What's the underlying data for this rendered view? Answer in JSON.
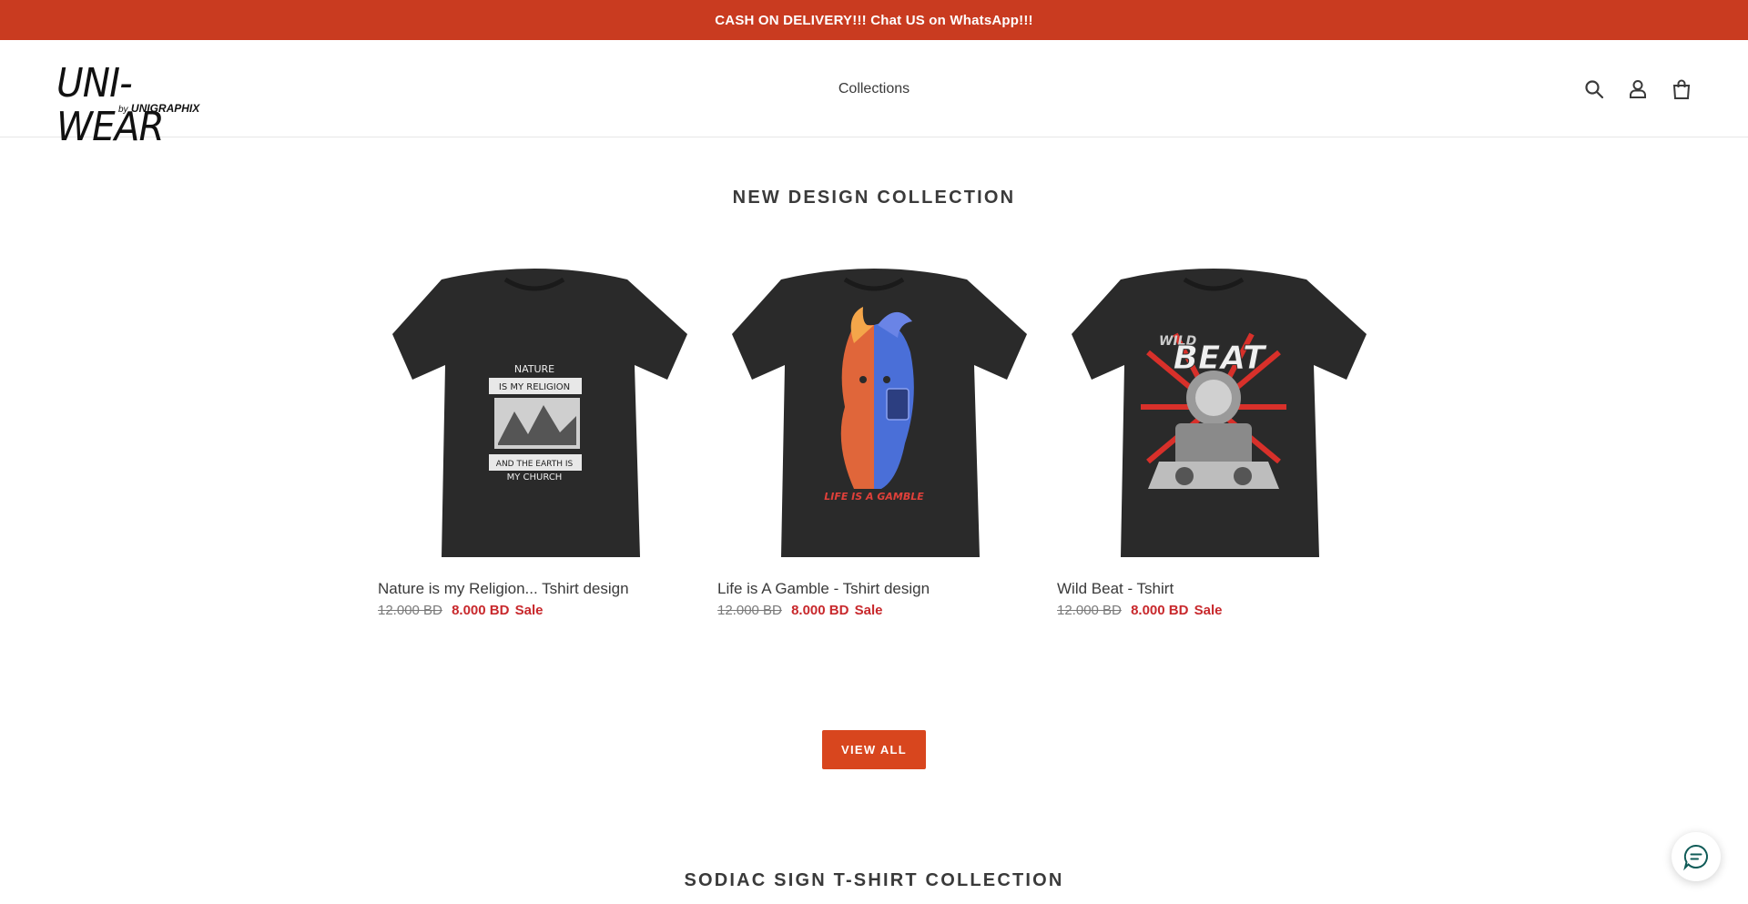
{
  "announcement": {
    "text": "CASH ON DELIVERY!!! Chat US on WhatsApp!!!"
  },
  "header": {
    "logo_text": "UNI-WEAR",
    "logo_sub_by": "by",
    "logo_sub_brand": "UNIGRAPHIX",
    "nav": [
      {
        "label": "Collections"
      }
    ],
    "icons": [
      "search-icon",
      "account-icon",
      "cart-icon"
    ]
  },
  "section1": {
    "title": "NEW DESIGN COLLECTION",
    "products": [
      {
        "title": "Nature is my Religion... Tshirt design",
        "price_old": "12.000 BD",
        "price_new": "8.000 BD",
        "sale_label": "Sale",
        "image_text": [
          "NATURE",
          "IS MY RELIGION",
          "AND THE EARTH IS",
          "MY CHURCH"
        ]
      },
      {
        "title": "Life is A Gamble - Tshirt design",
        "price_old": "12.000 BD",
        "price_new": "8.000 BD",
        "sale_label": "Sale",
        "image_text": [
          "LIFE IS A GAMBLE"
        ]
      },
      {
        "title": "Wild Beat - Tshirt",
        "price_old": "12.000 BD",
        "price_new": "8.000 BD",
        "sale_label": "Sale",
        "image_text": [
          "WILD",
          "BEAT"
        ]
      }
    ],
    "view_all_label": "VIEW ALL"
  },
  "section2": {
    "title": "SODIAC SIGN T-SHIRT COLLECTION"
  },
  "colors": {
    "announcement_bg": "#c93b20",
    "button_bg": "#d8461e",
    "sale_red": "#c8282c"
  },
  "chat": {
    "icon": "chat-icon"
  }
}
